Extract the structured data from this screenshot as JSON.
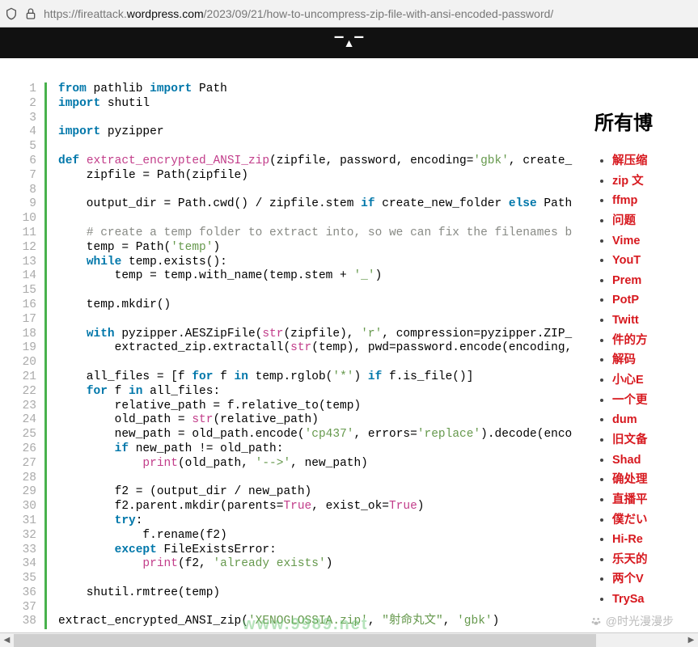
{
  "url": {
    "prefix": "https://fireattack.",
    "highlight": "wordpress.com",
    "suffix": "/2023/09/21/how-to-uncompress-zip-file-with-ansi-encoded-password/"
  },
  "code": {
    "lines": [
      [
        {
          "t": "from",
          "c": "kw"
        },
        {
          "t": " pathlib "
        },
        {
          "t": "import",
          "c": "kw"
        },
        {
          "t": " Path"
        }
      ],
      [
        {
          "t": "import",
          "c": "kw"
        },
        {
          "t": " shutil"
        }
      ],
      [],
      [
        {
          "t": "import",
          "c": "kw"
        },
        {
          "t": " pyzipper"
        }
      ],
      [],
      [
        {
          "t": "def",
          "c": "kw"
        },
        {
          "t": " "
        },
        {
          "t": "extract_encrypted_ANSI_zip",
          "c": "fn"
        },
        {
          "t": "(zipfile, password, encoding="
        },
        {
          "t": "'gbk'",
          "c": "str"
        },
        {
          "t": ", create_"
        }
      ],
      [
        {
          "t": "    zipfile = Path(zipfile)"
        }
      ],
      [],
      [
        {
          "t": "    output_dir = Path.cwd() / zipfile.stem "
        },
        {
          "t": "if",
          "c": "kw"
        },
        {
          "t": " create_new_folder "
        },
        {
          "t": "else",
          "c": "kw"
        },
        {
          "t": " Path"
        }
      ],
      [],
      [
        {
          "t": "    "
        },
        {
          "t": "# create a temp folder to extract into, so we can fix the filenames b",
          "c": "cmt"
        }
      ],
      [
        {
          "t": "    temp = Path("
        },
        {
          "t": "'temp'",
          "c": "str"
        },
        {
          "t": ")"
        }
      ],
      [
        {
          "t": "    "
        },
        {
          "t": "while",
          "c": "kw"
        },
        {
          "t": " temp.exists():"
        }
      ],
      [
        {
          "t": "        temp = temp.with_name(temp.stem + "
        },
        {
          "t": "'_'",
          "c": "str"
        },
        {
          "t": ")"
        }
      ],
      [],
      [
        {
          "t": "    temp.mkdir()"
        }
      ],
      [],
      [
        {
          "t": "    "
        },
        {
          "t": "with",
          "c": "kw"
        },
        {
          "t": " pyzipper.AESZipFile("
        },
        {
          "t": "str",
          "c": "fn"
        },
        {
          "t": "(zipfile), "
        },
        {
          "t": "'r'",
          "c": "str"
        },
        {
          "t": ", compression=pyzipper.ZIP_"
        }
      ],
      [
        {
          "t": "        extracted_zip.extractall("
        },
        {
          "t": "str",
          "c": "fn"
        },
        {
          "t": "(temp), pwd=password.encode(encoding,"
        }
      ],
      [],
      [
        {
          "t": "    all_files = [f "
        },
        {
          "t": "for",
          "c": "kw"
        },
        {
          "t": " f "
        },
        {
          "t": "in",
          "c": "kw"
        },
        {
          "t": " temp.rglob("
        },
        {
          "t": "'*'",
          "c": "str"
        },
        {
          "t": ") "
        },
        {
          "t": "if",
          "c": "kw"
        },
        {
          "t": " f.is_file()]"
        }
      ],
      [
        {
          "t": "    "
        },
        {
          "t": "for",
          "c": "kw"
        },
        {
          "t": " f "
        },
        {
          "t": "in",
          "c": "kw"
        },
        {
          "t": " all_files:"
        }
      ],
      [
        {
          "t": "        relative_path = f.relative_to(temp)"
        }
      ],
      [
        {
          "t": "        old_path = "
        },
        {
          "t": "str",
          "c": "fn"
        },
        {
          "t": "(relative_path)"
        }
      ],
      [
        {
          "t": "        new_path = old_path.encode("
        },
        {
          "t": "'cp437'",
          "c": "str"
        },
        {
          "t": ", errors="
        },
        {
          "t": "'replace'",
          "c": "str"
        },
        {
          "t": ").decode(enco"
        }
      ],
      [
        {
          "t": "        "
        },
        {
          "t": "if",
          "c": "kw"
        },
        {
          "t": " new_path != old_path:"
        }
      ],
      [
        {
          "t": "            "
        },
        {
          "t": "print",
          "c": "fn"
        },
        {
          "t": "(old_path, "
        },
        {
          "t": "'-->'",
          "c": "str"
        },
        {
          "t": ", new_path)"
        }
      ],
      [],
      [
        {
          "t": "        f2 = (output_dir / new_path)"
        }
      ],
      [
        {
          "t": "        f2.parent.mkdir(parents="
        },
        {
          "t": "True",
          "c": "bool"
        },
        {
          "t": ", exist_ok="
        },
        {
          "t": "True",
          "c": "bool"
        },
        {
          "t": ")"
        }
      ],
      [
        {
          "t": "        "
        },
        {
          "t": "try",
          "c": "kw"
        },
        {
          "t": ":"
        }
      ],
      [
        {
          "t": "            f.rename(f2)"
        }
      ],
      [
        {
          "t": "        "
        },
        {
          "t": "except",
          "c": "kw"
        },
        {
          "t": " FileExistsError:"
        }
      ],
      [
        {
          "t": "            "
        },
        {
          "t": "print",
          "c": "fn"
        },
        {
          "t": "(f2, "
        },
        {
          "t": "'already exists'",
          "c": "str"
        },
        {
          "t": ")"
        }
      ],
      [],
      [
        {
          "t": "    shutil.rmtree(temp)"
        }
      ],
      [],
      [
        {
          "t": "extract_encrypted_ANSI_zip("
        },
        {
          "t": "'XENOGLOSSIA.zip'",
          "c": "str"
        },
        {
          "t": ", "
        },
        {
          "t": "\"射命丸文\"",
          "c": "str"
        },
        {
          "t": ", "
        },
        {
          "t": "'gbk'",
          "c": "str"
        },
        {
          "t": ")"
        }
      ]
    ]
  },
  "sidebar": {
    "heading": "所有博",
    "items": [
      "解压缩",
      "zip 文",
      "ffmp",
      "问题",
      "Vime",
      "YouT",
      "Prem",
      "PotP",
      "Twitt",
      "件的方",
      "解码",
      "小心E",
      "一个更",
      "dum",
      "旧文备",
      "Shad",
      "确处理",
      "直播平",
      "僕だい",
      "Hi-Re",
      "乐天的",
      "两个V",
      "TrySa"
    ]
  },
  "watermark": {
    "text": "@时光漫漫步",
    "green": "www.9989.net"
  }
}
